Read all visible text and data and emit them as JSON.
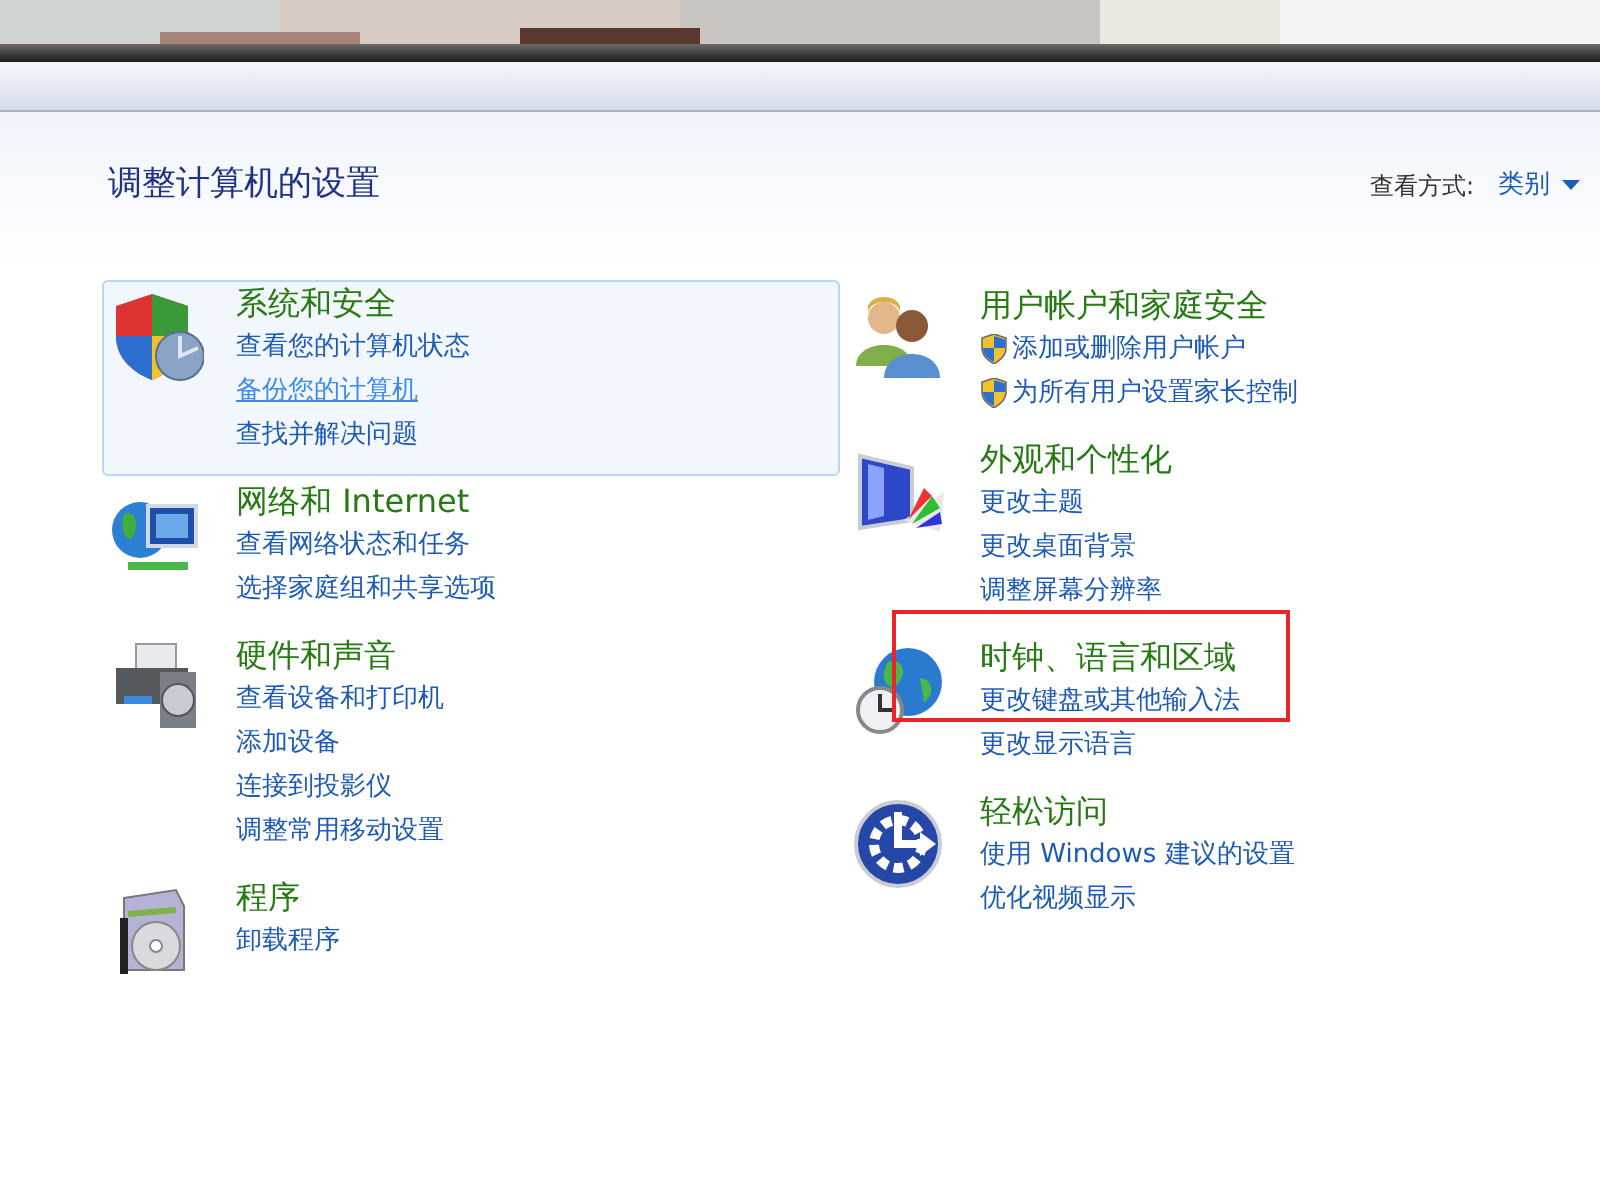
{
  "header": {
    "title": "调整计算机的设置",
    "view_label": "查看方式:",
    "view_value": "类别"
  },
  "columns": [
    {
      "sections": [
        {
          "kind": "shield",
          "heading": "系统和安全",
          "highlighted": true,
          "links": [
            {
              "text": "查看您的计算机状态",
              "hovered": false
            },
            {
              "text": "备份您的计算机",
              "hovered": true
            },
            {
              "text": "查找并解决问题",
              "hovered": false
            }
          ]
        },
        {
          "kind": "network",
          "heading": "网络和 Internet",
          "highlighted": false,
          "links": [
            {
              "text": "查看网络状态和任务",
              "hovered": false
            },
            {
              "text": "选择家庭组和共享选项",
              "hovered": false
            }
          ]
        },
        {
          "kind": "printer",
          "heading": "硬件和声音",
          "highlighted": false,
          "links": [
            {
              "text": "查看设备和打印机",
              "hovered": false
            },
            {
              "text": "添加设备",
              "hovered": false
            },
            {
              "text": "连接到投影仪",
              "hovered": false
            },
            {
              "text": "调整常用移动设置",
              "hovered": false
            }
          ]
        },
        {
          "kind": "programs",
          "heading": "程序",
          "highlighted": false,
          "links": [
            {
              "text": "卸载程序",
              "hovered": false
            }
          ]
        }
      ]
    },
    {
      "sections": [
        {
          "kind": "users",
          "heading": "用户帐户和家庭安全",
          "highlighted": false,
          "links": [
            {
              "text": "添加或删除用户帐户",
              "hovered": false,
              "shield": true
            },
            {
              "text": "为所有用户设置家长控制",
              "hovered": false,
              "shield": true
            }
          ]
        },
        {
          "kind": "display",
          "heading": "外观和个性化",
          "highlighted": false,
          "links": [
            {
              "text": "更改主题",
              "hovered": false
            },
            {
              "text": "更改桌面背景",
              "hovered": false
            },
            {
              "text": "调整屏幕分辨率",
              "hovered": false
            }
          ]
        },
        {
          "kind": "globe",
          "heading": "时钟、语言和区域",
          "highlighted": false,
          "links": [
            {
              "text": "更改键盘或其他输入法",
              "hovered": false
            },
            {
              "text": "更改显示语言",
              "hovered": false
            }
          ]
        },
        {
          "kind": "access",
          "heading": "轻松访问",
          "highlighted": false,
          "links": [
            {
              "text": "使用 Windows 建议的设置",
              "hovered": false
            },
            {
              "text": "优化视频显示",
              "hovered": false
            }
          ]
        }
      ]
    }
  ]
}
